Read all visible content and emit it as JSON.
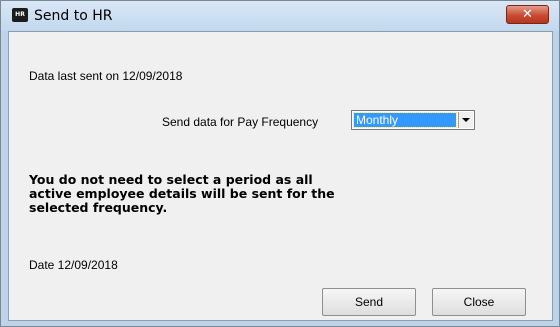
{
  "window": {
    "title": "Send to HR",
    "app_icon_label": "HR",
    "close_glyph": "✕"
  },
  "content": {
    "last_sent_text": "Data last sent on 12/09/2018",
    "pay_frequency_label": "Send data for Pay Frequency",
    "pay_frequency_selected": "Monthly",
    "info_text": "You do not need to select a period as all active employee details will be sent for the selected frequency.",
    "date_text": "Date 12/09/2018"
  },
  "buttons": {
    "send_label": "Send",
    "close_label": "Close"
  },
  "colors": {
    "selection_highlight": "#3399ff",
    "close_button": "#c84b33",
    "title_bar": "#c2d8ee"
  }
}
